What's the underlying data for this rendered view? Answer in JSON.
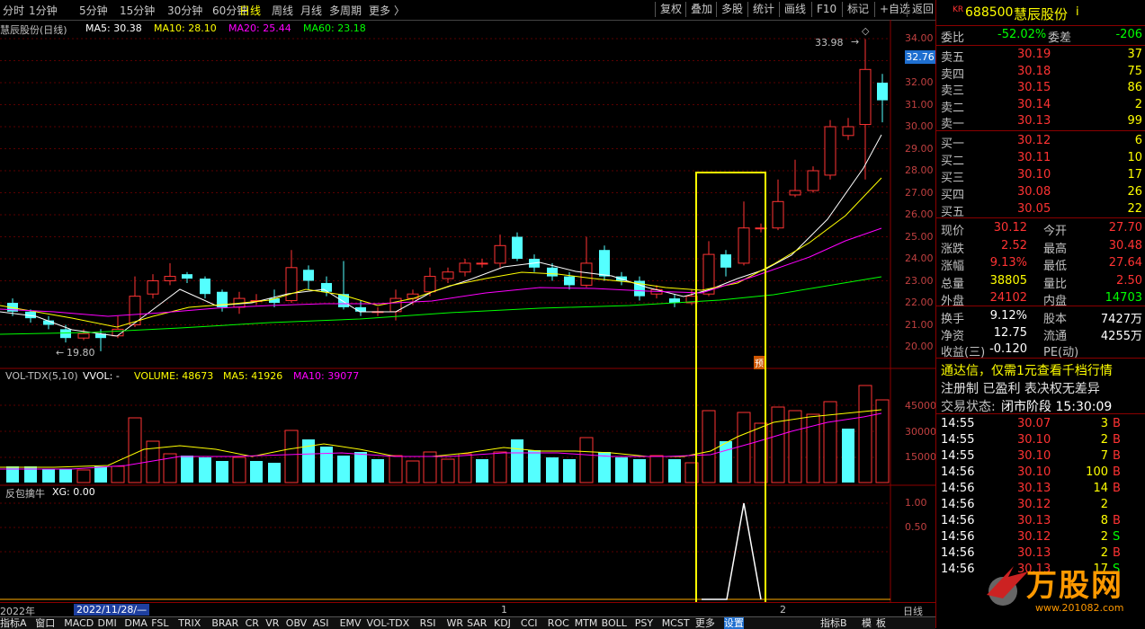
{
  "toolbar": {
    "periods": [
      "分时",
      "1分钟",
      "5分钟",
      "15分钟",
      "30分钟",
      "60分钟",
      "日线",
      "周线",
      "月线",
      "多周期",
      "更多"
    ],
    "active_period": "日线",
    "more_arrow": "〈",
    "right_buttons": [
      "复权",
      "叠加",
      "多股",
      "统计",
      "画线",
      "F10",
      "标记",
      "+自选",
      "返回"
    ]
  },
  "main_chart": {
    "title": "慧辰股份(日线)",
    "ma_labels": [
      {
        "text": "MA5: 30.38",
        "color": "#ffffff"
      },
      {
        "text": "MA10: 28.10",
        "color": "#ffff00"
      },
      {
        "text": "MA20: 25.44",
        "color": "#ff00ff"
      },
      {
        "text": "MA60: 23.18",
        "color": "#00ff00"
      }
    ],
    "y_ticks": [
      "34.00",
      "33.00",
      "32.00",
      "31.00",
      "30.00",
      "29.00",
      "28.00",
      "27.00",
      "26.00",
      "25.00",
      "24.00",
      "23.00",
      "22.00",
      "21.00",
      "20.00"
    ],
    "current_price_tag": "32.76",
    "high_annotation": "33.98",
    "low_annotation": "19.80",
    "small_marker": "预"
  },
  "volume_chart": {
    "title": "VOL-TDX(5,10)",
    "labels": [
      {
        "text": "VVOL: -",
        "color": "#ffffff"
      },
      {
        "text": "VOLUME: 48673",
        "color": "#ffff00"
      },
      {
        "text": "MA5: 41926",
        "color": "#ffff00"
      },
      {
        "text": "MA10: 39077",
        "color": "#ff00ff"
      }
    ],
    "y_ticks": [
      "45000",
      "30000",
      "15000"
    ]
  },
  "indicator_chart": {
    "title": "反包擒牛",
    "label": "XG: 0.00",
    "y_ticks": [
      "1.00",
      "0.50"
    ]
  },
  "time_axis": {
    "year_label": "2022年",
    "date_box": "2022/11/28/—",
    "month_1": "1",
    "month_2": "2",
    "right_label": "日线"
  },
  "bottom_tabs": [
    "指标A",
    "窗口",
    "MACD",
    "DMI",
    "DMA",
    "FSL",
    "TRIX",
    "BRAR",
    "CR",
    "VR",
    "OBV",
    "ASI",
    "EMV",
    "VOL-TDX",
    "RSI",
    "WR",
    "SAR",
    "KDJ",
    "CCI",
    "ROC",
    "MTM",
    "BOLL",
    "PSY",
    "MCST",
    "更多",
    "设置"
  ],
  "bottom_right_tabs": [
    "指标B",
    "模",
    "板"
  ],
  "quote_panel": {
    "prefix": "KR",
    "code": "688500",
    "name": "慧辰股份",
    "info_mark": "i",
    "weibi_label": "委比",
    "weibi_value": "-52.02%",
    "weicha_label": "委差",
    "weicha_value": "-206",
    "sell": [
      {
        "label": "卖五",
        "price": "30.19",
        "vol": "37"
      },
      {
        "label": "卖四",
        "price": "30.18",
        "vol": "75"
      },
      {
        "label": "卖三",
        "price": "30.15",
        "vol": "86"
      },
      {
        "label": "卖二",
        "price": "30.14",
        "vol": "2"
      },
      {
        "label": "卖一",
        "price": "30.13",
        "vol": "99"
      }
    ],
    "buy": [
      {
        "label": "买一",
        "price": "30.12",
        "vol": "6"
      },
      {
        "label": "买二",
        "price": "30.11",
        "vol": "10"
      },
      {
        "label": "买三",
        "price": "30.10",
        "vol": "17"
      },
      {
        "label": "买四",
        "price": "30.08",
        "vol": "26"
      },
      {
        "label": "买五",
        "price": "30.05",
        "vol": "22"
      }
    ],
    "stats": [
      {
        "l1": "现价",
        "v1": "30.12",
        "c1": "#ff3333",
        "l2": "今开",
        "v2": "27.70",
        "c2": "#ff3333"
      },
      {
        "l1": "涨跌",
        "v1": "2.52",
        "c1": "#ff3333",
        "l2": "最高",
        "v2": "30.48",
        "c2": "#ff3333"
      },
      {
        "l1": "涨幅",
        "v1": "9.13%",
        "c1": "#ff3333",
        "l2": "最低",
        "v2": "27.64",
        "c2": "#ff3333"
      },
      {
        "l1": "总量",
        "v1": "38805",
        "c1": "#ffff00",
        "l2": "量比",
        "v2": "2.50",
        "c2": "#ff3333"
      },
      {
        "l1": "外盘",
        "v1": "24102",
        "c1": "#ff3333",
        "l2": "内盘",
        "v2": "14703",
        "c2": "#00ff00"
      }
    ],
    "stats2": [
      {
        "l1": "换手",
        "v1": "9.12%",
        "l2": "股本",
        "v2": "7427万"
      },
      {
        "l1": "净资",
        "v1": "12.75",
        "l2": "流通",
        "v2": "4255万"
      },
      {
        "l1": "收益(三)",
        "v1": "-0.120",
        "l2": "PE(动)",
        "v2": ""
      }
    ],
    "ad_line": "通达信，仅需1元查看千档行情",
    "notice_line": "注册制 已盈利 表决权无差异",
    "status_label": "交易状态:",
    "status_value": "闭市阶段 15:30:09",
    "ticks": [
      {
        "time": "14:55",
        "price": "30.07",
        "vol": "3",
        "bs": "B"
      },
      {
        "time": "14:55",
        "price": "30.10",
        "vol": "2",
        "bs": "B"
      },
      {
        "time": "14:55",
        "price": "30.10",
        "vol": "7",
        "bs": "B"
      },
      {
        "time": "14:56",
        "price": "30.10",
        "vol": "100",
        "bs": "B"
      },
      {
        "time": "14:56",
        "price": "30.13",
        "vol": "14",
        "bs": "B"
      },
      {
        "time": "14:56",
        "price": "30.12",
        "vol": "2",
        "bs": ""
      },
      {
        "time": "14:56",
        "price": "30.13",
        "vol": "8",
        "bs": "B"
      },
      {
        "time": "14:56",
        "price": "30.12",
        "vol": "2",
        "bs": "S"
      },
      {
        "time": "14:56",
        "price": "30.13",
        "vol": "2",
        "bs": "B"
      },
      {
        "time": "14:56",
        "price": "30.13",
        "vol": "17",
        "bs": "S"
      }
    ]
  },
  "watermark": {
    "brand": "万股网",
    "url": "www.201082.com"
  },
  "colors": {
    "up": "#ff3333",
    "down": "#54ffff",
    "ma5": "#ffffff",
    "ma10": "#ffff00",
    "ma20": "#ff00ff",
    "ma60": "#00ff00",
    "highlight": "#ffff00"
  }
}
